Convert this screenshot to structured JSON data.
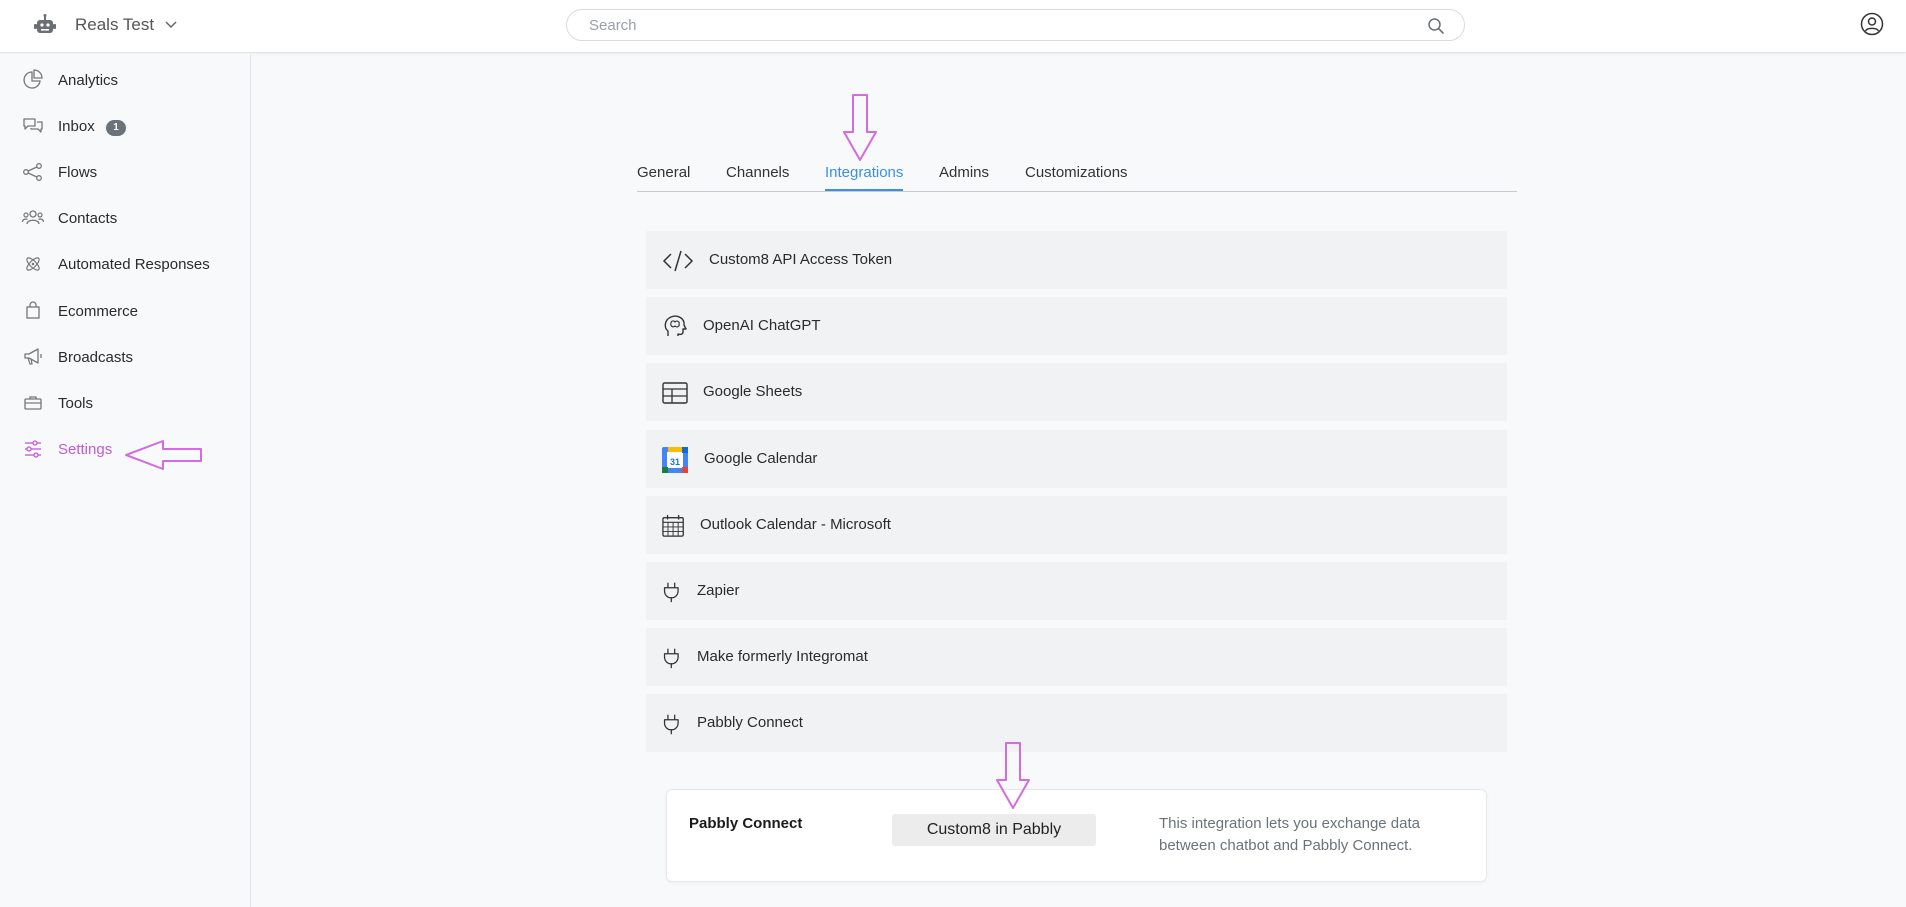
{
  "header": {
    "workspace_name": "Reals Test",
    "search_placeholder": "Search"
  },
  "sidebar": {
    "items": [
      {
        "label": "Analytics",
        "icon": "analytics-icon"
      },
      {
        "label": "Inbox",
        "icon": "inbox-icon",
        "badge": "1"
      },
      {
        "label": "Flows",
        "icon": "flows-icon"
      },
      {
        "label": "Contacts",
        "icon": "contacts-icon"
      },
      {
        "label": "Automated Responses",
        "icon": "automated-responses-icon"
      },
      {
        "label": "Ecommerce",
        "icon": "shopping-bag-icon"
      },
      {
        "label": "Broadcasts",
        "icon": "megaphone-icon"
      },
      {
        "label": "Tools",
        "icon": "briefcase-icon"
      },
      {
        "label": "Settings",
        "icon": "sliders-icon",
        "active": true
      }
    ]
  },
  "tabs": [
    {
      "label": "General"
    },
    {
      "label": "Channels"
    },
    {
      "label": "Integrations",
      "active": true
    },
    {
      "label": "Admins"
    },
    {
      "label": "Customizations"
    }
  ],
  "integrations": [
    {
      "label": "Custom8 API Access Token",
      "icon": "code-icon"
    },
    {
      "label": "OpenAI ChatGPT",
      "icon": "brain-head-icon"
    },
    {
      "label": "Google Sheets",
      "icon": "table-icon"
    },
    {
      "label": "Google Calendar",
      "icon": "google-calendar-icon"
    },
    {
      "label": "Outlook Calendar - Microsoft",
      "icon": "calendar-grid-icon"
    },
    {
      "label": "Zapier",
      "icon": "plug-icon"
    },
    {
      "label": "Make formerly Integromat",
      "icon": "plug-icon"
    },
    {
      "label": "Pabbly Connect",
      "icon": "plug-icon"
    }
  ],
  "detail": {
    "title": "Pabbly Connect",
    "button_label": "Custom8 in Pabbly",
    "description": "This integration lets you exchange data between chatbot and Pabbly Connect."
  },
  "google_calendar_day": "31",
  "colors": {
    "accent": "#3b8fe5",
    "active_nav": "#c45ad6",
    "annotation": "#d46be0",
    "badge_bg": "#6c727a",
    "row_bg": "#f1f2f3"
  }
}
